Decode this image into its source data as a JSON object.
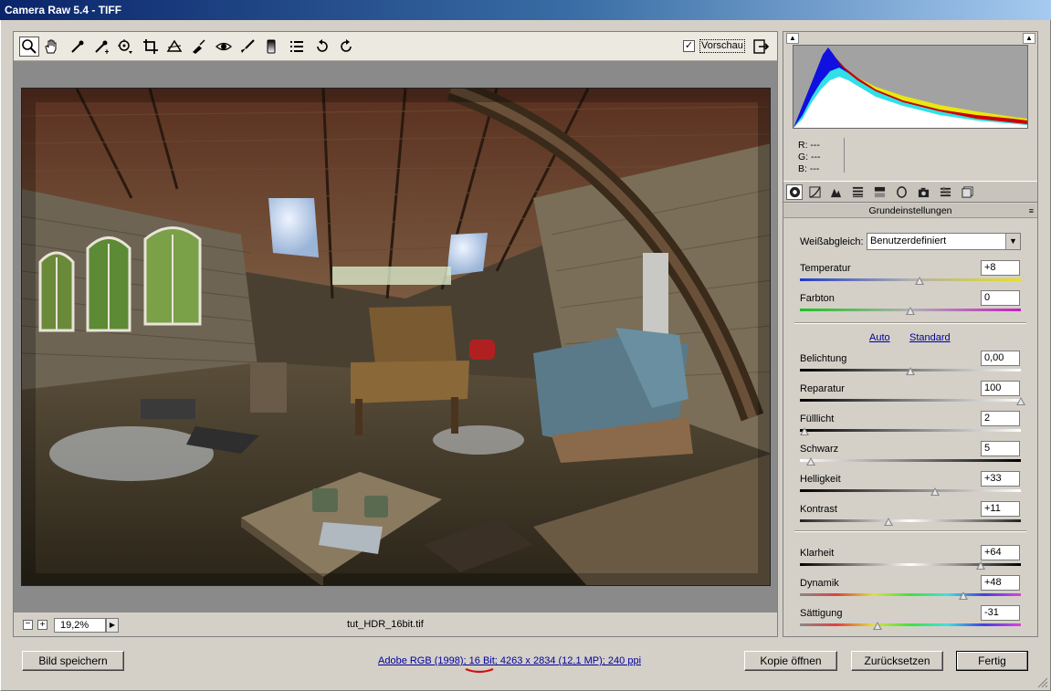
{
  "window": {
    "title": "Camera Raw 5.4 - TIFF"
  },
  "toolbar": {
    "preview_label": "Vorschau",
    "preview_checked": true,
    "tools": [
      "zoom-tool",
      "hand-tool",
      "white-balance-tool",
      "color-sampler-tool",
      "targeted-adjustment-tool",
      "crop-tool",
      "straighten-tool",
      "spot-removal-tool",
      "red-eye-tool",
      "adjustment-brush-tool",
      "graduated-filter-tool",
      "preferences-tool",
      "rotate-ccw-tool",
      "rotate-cw-tool"
    ]
  },
  "status": {
    "zoom_value": "19,2%",
    "filename": "tut_HDR_16bit.tif"
  },
  "readout": {
    "r": "R:   ---",
    "g": "G:   ---",
    "b": "B:   ---"
  },
  "panel": {
    "section_title": "Grundeinstellungen",
    "wb_label": "Weißabgleich:",
    "wb_value": "Benutzerdefiniert",
    "auto_label": "Auto",
    "standard_label": "Standard",
    "sliders": [
      {
        "label": "Temperatur",
        "value": "+8",
        "level": 0.54
      },
      {
        "label": "Farbton",
        "value": "0",
        "level": 0.5
      },
      {
        "label": "Belichtung",
        "value": "0,00",
        "level": 0.5
      },
      {
        "label": "Reparatur",
        "value": "100",
        "level": 1.0
      },
      {
        "label": "Fülllicht",
        "value": "2",
        "level": 0.02
      },
      {
        "label": "Schwarz",
        "value": "5",
        "level": 0.05
      },
      {
        "label": "Helligkeit",
        "value": "+33",
        "level": 0.61
      },
      {
        "label": "Kontrast",
        "value": "+11",
        "level": 0.4
      },
      {
        "label": "Klarheit",
        "value": "+64",
        "level": 0.82
      },
      {
        "label": "Dynamik",
        "value": "+48",
        "level": 0.74
      },
      {
        "label": "Sättigung",
        "value": "-31",
        "level": 0.35
      }
    ]
  },
  "footer": {
    "save_label": "Bild speichern",
    "info_link": "Adobe RGB (1998); 16 Bit; 4263 x 2834 (12,1 MP); 240 ppi",
    "open_copy_label": "Kopie öffnen",
    "reset_label": "Zurücksetzen",
    "done_label": "Fertig"
  }
}
